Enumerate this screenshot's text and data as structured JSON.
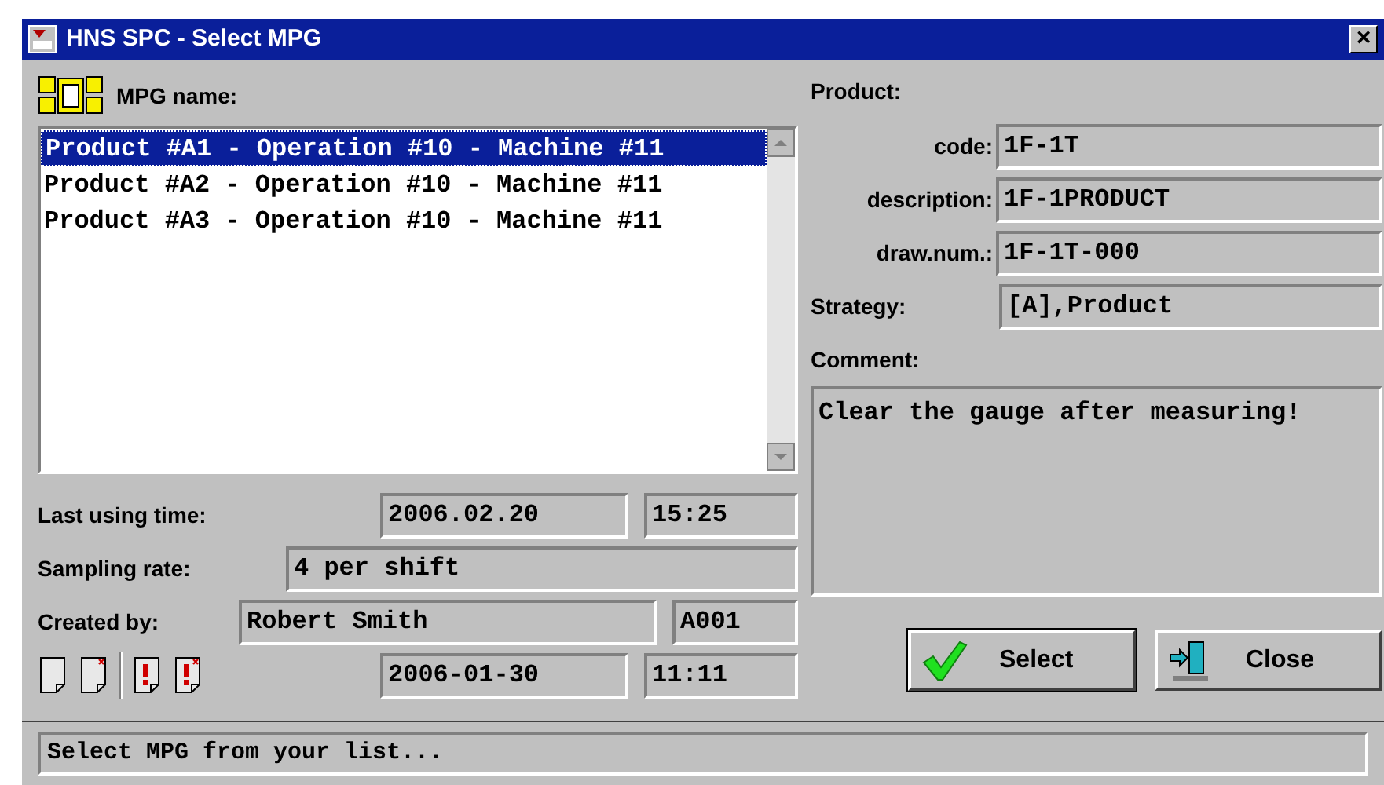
{
  "window": {
    "title": "HNS SPC - Select MPG",
    "close": "×"
  },
  "mpg_list": {
    "label": "MPG name:",
    "items": [
      {
        "text": "Product #A1 - Operation #10 - Machine #11",
        "selected": true
      },
      {
        "text": "Product #A2 - Operation #10 - Machine #11",
        "selected": false
      },
      {
        "text": "Product #A3 - Operation #10 - Machine #11",
        "selected": false
      }
    ]
  },
  "last_using_time": {
    "label": "Last using time:",
    "date": "2006.02.20",
    "time": "15:25"
  },
  "sampling_rate": {
    "label": "Sampling rate:",
    "value": "4 per shift"
  },
  "created_by": {
    "label": "Created by:",
    "name": "Robert Smith",
    "code": "A001",
    "date": "2006-01-30",
    "time": "11:11"
  },
  "product": {
    "heading": "Product:",
    "fields": [
      {
        "label": "code:",
        "value": "1F-1T"
      },
      {
        "label": "description:",
        "value": "1F-1PRODUCT"
      },
      {
        "label": "draw.num.:",
        "value": "1F-1T-000"
      }
    ]
  },
  "strategy": {
    "label": "Strategy:",
    "value": "[A],Product"
  },
  "comment": {
    "label": "Comment:",
    "value": "Clear the gauge after measuring!"
  },
  "buttons": [
    {
      "label": "Select",
      "kind": "select"
    },
    {
      "label": "Close",
      "kind": "close"
    }
  ],
  "status_bar": "Select MPG from your list..."
}
